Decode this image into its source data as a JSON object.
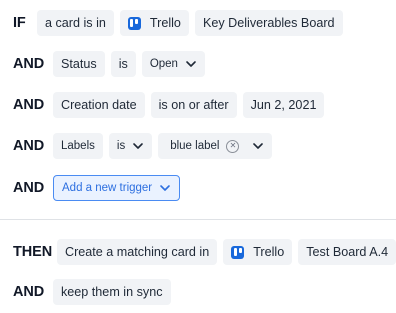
{
  "conditions": {
    "if_row": {
      "keyword": "IF",
      "subject": "a card is in",
      "app": "Trello",
      "board": "Key Deliverables Board"
    },
    "status_row": {
      "keyword": "AND",
      "field": "Status",
      "operator": "is",
      "value": "Open"
    },
    "date_row": {
      "keyword": "AND",
      "field": "Creation date",
      "operator": "is on or after",
      "value": "Jun 2, 2021"
    },
    "labels_row": {
      "keyword": "AND",
      "field": "Labels",
      "operator": "is",
      "value": "blue label",
      "clear_icon": "x-circle-icon"
    },
    "add_row": {
      "keyword": "AND",
      "button_label": "Add a new trigger"
    }
  },
  "actions": {
    "then_row": {
      "keyword": "THEN",
      "action": "Create a matching card in",
      "app": "Trello",
      "board": "Test Board A.4"
    },
    "sync_row": {
      "keyword": "AND",
      "action": "keep them in sync"
    }
  },
  "colors": {
    "chip_bg": "#f1f3f6",
    "accent_blue": "#2d6fe0",
    "trello_blue": "#1868db"
  }
}
